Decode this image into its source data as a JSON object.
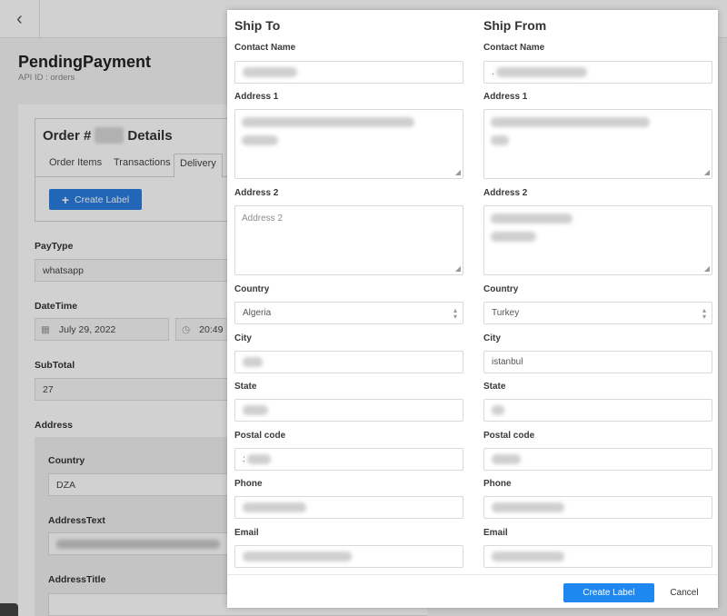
{
  "background": {
    "page_title": "PendingPayment",
    "api_id": "API ID : orders",
    "order_title_prefix": "Order #",
    "order_title_suffix": "Details",
    "tabs": [
      "Order Items",
      "Transactions",
      "Delivery"
    ],
    "create_label": "Create Label",
    "paytype_label": "PayType",
    "paytype_value": "whatsapp",
    "datetime_label": "DateTime",
    "date_value": "July 29, 2022",
    "time_value": "20:49",
    "subtotal_label": "SubTotal",
    "subtotal_value": "27",
    "address_label": "Address",
    "country_label": "Country",
    "country_value": "DZA",
    "addresstext_label": "AddressText",
    "addresstitle_label": "AddressTitle"
  },
  "modal": {
    "ship_to": {
      "title": "Ship To",
      "contact_name_label": "Contact Name",
      "address1_label": "Address 1",
      "address2_label": "Address 2",
      "address2_placeholder": "Address 2",
      "country_label": "Country",
      "country_value": "Algeria",
      "city_label": "City",
      "state_label": "State",
      "postal_label": "Postal code",
      "postal_value_visible": ":",
      "phone_label": "Phone",
      "email_label": "Email"
    },
    "ship_from": {
      "title": "Ship From",
      "contact_name_label": "Contact Name",
      "contact_name_visible": ".",
      "address1_label": "Address 1",
      "address2_label": "Address 2",
      "country_label": "Country",
      "country_value": "Turkey",
      "city_label": "City",
      "city_value": "istanbul",
      "state_label": "State",
      "postal_label": "Postal code",
      "phone_label": "Phone",
      "email_label": "Email"
    },
    "footer": {
      "create_label": "Create Label",
      "cancel": "Cancel"
    }
  },
  "colors": {
    "primary": "#1e87f0",
    "overlay": "rgba(0,0,0,0.18)"
  }
}
